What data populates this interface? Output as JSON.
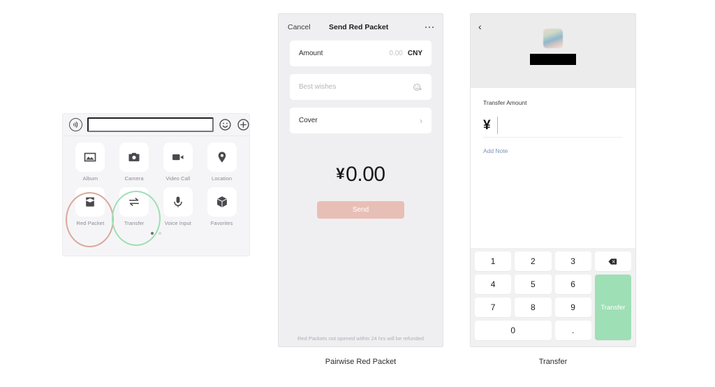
{
  "left_panel": {
    "input_bar": {
      "voice_icon": "voice-wave-icon",
      "text_value": "",
      "emoji_icon": "smiley-icon",
      "plus_icon": "plus-circle-icon"
    },
    "grid": [
      {
        "label": "Album",
        "icon": "image-icon"
      },
      {
        "label": "Camera",
        "icon": "camera-icon"
      },
      {
        "label": "Video Call",
        "icon": "video-camera-icon"
      },
      {
        "label": "Location",
        "icon": "map-pin-icon"
      },
      {
        "label": "Red Packet",
        "icon": "red-packet-icon"
      },
      {
        "label": "Transfer",
        "icon": "transfer-arrows-icon"
      },
      {
        "label": "Voice Input",
        "icon": "microphone-icon"
      },
      {
        "label": "Favorites",
        "icon": "cube-icon"
      }
    ],
    "page_dots": 2,
    "active_dot": 1,
    "highlights": {
      "red_packet_color": "#d9a99c",
      "transfer_color": "#9edfb4"
    }
  },
  "red_packet_screen": {
    "cancel_label": "Cancel",
    "title": "Send Red Packet",
    "more_icon": "ellipsis-icon",
    "amount_row": {
      "label": "Amount",
      "value": "0.00",
      "currency": "CNY"
    },
    "wishes_row": {
      "placeholder": "Best wishes",
      "emoji_icon": "smiley-plus-icon"
    },
    "cover_row": {
      "label": "Cover",
      "chevron": "chevron-right-icon"
    },
    "total": {
      "symbol": "¥",
      "value": "0.00"
    },
    "send_label": "Send",
    "send_color": "#e8bfb6",
    "footnote": "Red Packets not opened within 24 hrs will be refunded"
  },
  "transfer_screen": {
    "back_icon": "chevron-left-icon",
    "avatar": "contact-avatar",
    "contact_name_redacted": "",
    "amount_label": "Transfer Amount",
    "currency_symbol": "¥",
    "amount_value": "",
    "add_note_label": "Add Note",
    "add_note_color": "#7b93b8",
    "keypad": {
      "keys": [
        "1",
        "2",
        "3",
        "4",
        "5",
        "6",
        "7",
        "8",
        "9",
        "0",
        "."
      ],
      "delete_icon": "backspace-icon",
      "confirm_label": "Transfer",
      "confirm_color": "#9edfb6"
    }
  },
  "captions": {
    "middle": "Pairwise Red Packet",
    "right": "Transfer"
  }
}
